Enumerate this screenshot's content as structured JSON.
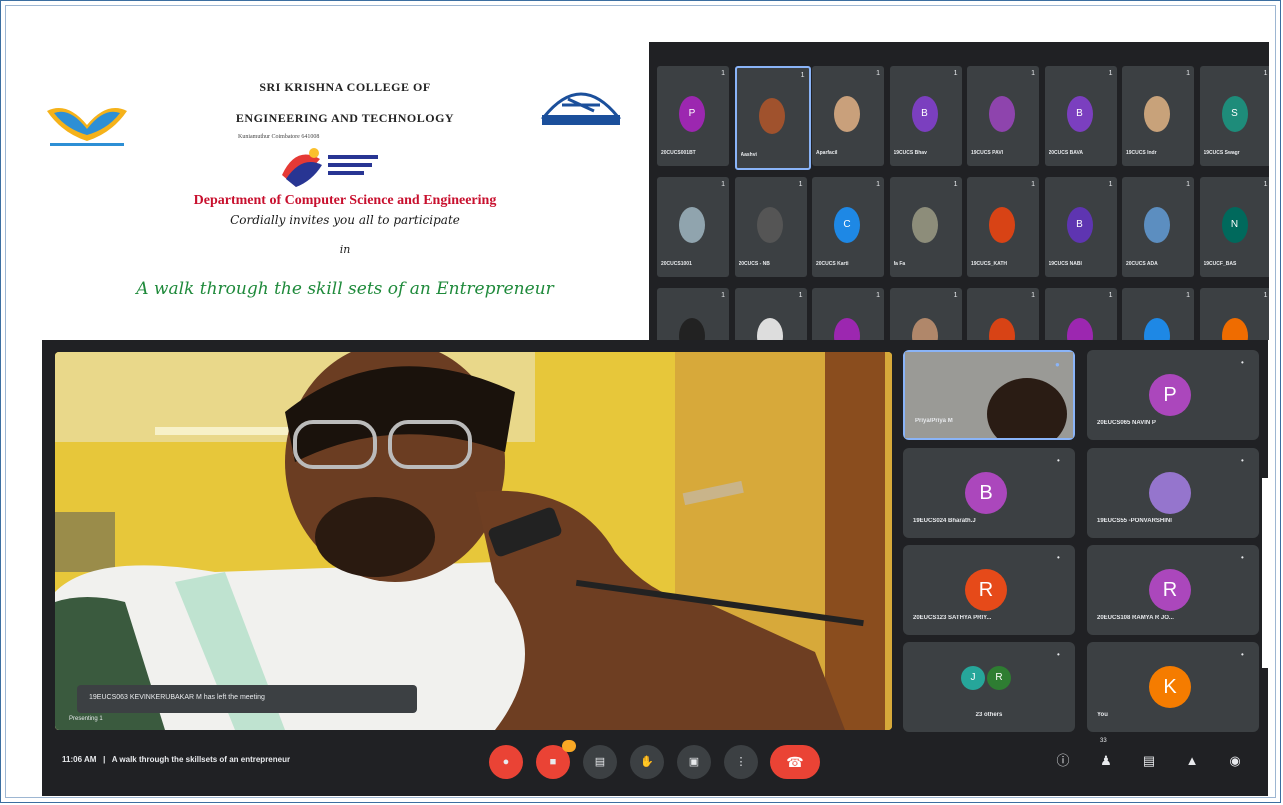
{
  "poster": {
    "college_line1": "SRI KRISHNA COLLEGE OF",
    "college_line2": "ENGINEERING AND TECHNOLOGY",
    "address": "Kuniamuthur Coimbatore 641008",
    "department": "Department of Computer Science and Engineering",
    "invite": "Cordially invites you all to participate",
    "in": "in",
    "event_title": "A walk through the skill sets of an Entrepreneur"
  },
  "top_grid": {
    "pin": "1",
    "tiles": [
      {
        "name": "20CUCS001BT",
        "initial": "P",
        "color": "#9c27b0"
      },
      {
        "name": "Aashvi",
        "initial": "",
        "color": "#a0522d"
      },
      {
        "name": "Aparfacil",
        "initial": "",
        "color": "#c9a07b"
      },
      {
        "name": "19CUCS Bhav",
        "initial": "B",
        "color": "#7b3fbf"
      },
      {
        "name": "19CUCS PAVI",
        "initial": "",
        "color": "#8e44ad"
      },
      {
        "name": "20CUCS BAVA",
        "initial": "B",
        "color": "#7b3fbf"
      },
      {
        "name": "19CUCS Indr",
        "initial": "",
        "color": "#c8a27a"
      },
      {
        "name": "19CUCS Swagr",
        "initial": "S",
        "color": "#1e8c7a"
      },
      {
        "name": "20CUCS1001",
        "initial": "",
        "color": "#90a4ae"
      },
      {
        "name": "20CUCS - NB",
        "initial": "",
        "color": "#555"
      },
      {
        "name": "20CUCS Karti",
        "initial": "C",
        "color": "#1e88e5"
      },
      {
        "name": "fa Fa",
        "initial": "",
        "color": "#8d8d7a"
      },
      {
        "name": "19CUCS_KATH",
        "initial": "",
        "color": "#d84315"
      },
      {
        "name": "19CUCS NABI",
        "initial": "B",
        "color": "#5e35b1"
      },
      {
        "name": "20CUCS ADA",
        "initial": "",
        "color": "#5c8ec0"
      },
      {
        "name": "19CUCF_BAS",
        "initial": "N",
        "color": "#00695c"
      },
      {
        "name": "",
        "initial": "",
        "color": "#222"
      },
      {
        "name": "",
        "initial": "",
        "color": "#ddd"
      },
      {
        "name": "",
        "initial": "",
        "color": "#9c27b0"
      },
      {
        "name": "",
        "initial": "",
        "color": "#b0876a"
      },
      {
        "name": "",
        "initial": "",
        "color": "#d84315"
      },
      {
        "name": "",
        "initial": "",
        "color": "#9c27b0"
      },
      {
        "name": "",
        "initial": "",
        "color": "#1e88e5"
      },
      {
        "name": "",
        "initial": "",
        "color": "#ef6c00"
      }
    ]
  },
  "meet": {
    "toast": "19EUCS063 KEVINKERUBAKAR M has left the meeting",
    "presenting": "Presenting 1",
    "participants": [
      {
        "name": "Priya/Priya M",
        "initial": "",
        "color": "#444"
      },
      {
        "name": "20EUCS065 NAVIN P",
        "initial": "P",
        "color": "#ab47bc"
      },
      {
        "name": "19EUCS024 Bharath.J",
        "initial": "B",
        "color": "#ab47bc"
      },
      {
        "name": "19EUCS55 -PONVARSHINI",
        "initial": "",
        "color": "#9575cd"
      },
      {
        "name": "20EUCS123 SATHYA PRIY...",
        "initial": "R",
        "color": "#e64a19"
      },
      {
        "name": "20EUCS108 RAMYA R JO...",
        "initial": "R",
        "color": "#ab47bc"
      },
      {
        "name": "23 others",
        "initial": "",
        "color": "#26a69a"
      },
      {
        "name": "You",
        "initial": "K",
        "color": "#f57c00"
      }
    ],
    "others_avatars": [
      "J",
      "R"
    ],
    "time": "11:06 AM",
    "separator": "|",
    "meeting_title": "A walk through the skillsets of an entrepreneur",
    "people_count": "33"
  },
  "colors": {
    "meet_bg": "#202124",
    "tile_bg": "#3c4043",
    "hangup": "#ea4335",
    "accent_blue": "#8ab4f8"
  }
}
